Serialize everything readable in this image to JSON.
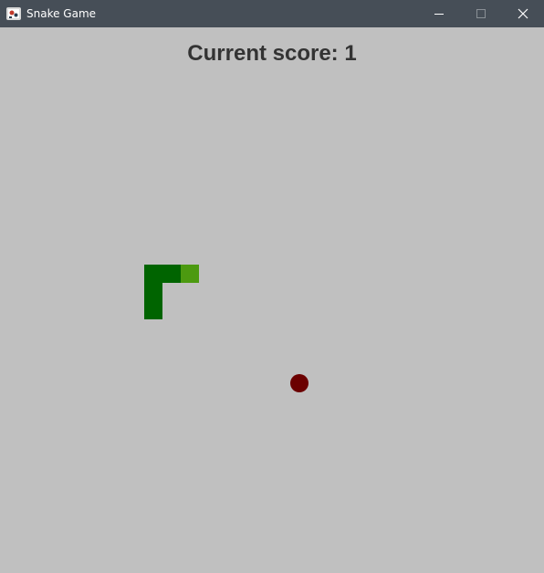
{
  "window": {
    "title": "Snake Game",
    "icon": "snake-game-app-icon",
    "controls": [
      "minimize-icon",
      "maximize-icon",
      "close-icon"
    ]
  },
  "game": {
    "score_text": "Current score: 1",
    "grid_unit": 20,
    "colors": {
      "background": "#c0c0c0",
      "snake_body": "#006400",
      "snake_head": "#4c9a10",
      "food": "#6b0000",
      "score_text": "#333333"
    },
    "snake": [
      {
        "col": 2,
        "row": 0,
        "part": "head"
      },
      {
        "col": 1,
        "row": 0,
        "part": "body"
      },
      {
        "col": 0,
        "row": 0,
        "part": "body"
      },
      {
        "col": 0,
        "row": 1,
        "part": "body"
      },
      {
        "col": 0,
        "row": 2,
        "part": "body"
      }
    ],
    "food": {
      "col": 8,
      "row": 6
    }
  }
}
